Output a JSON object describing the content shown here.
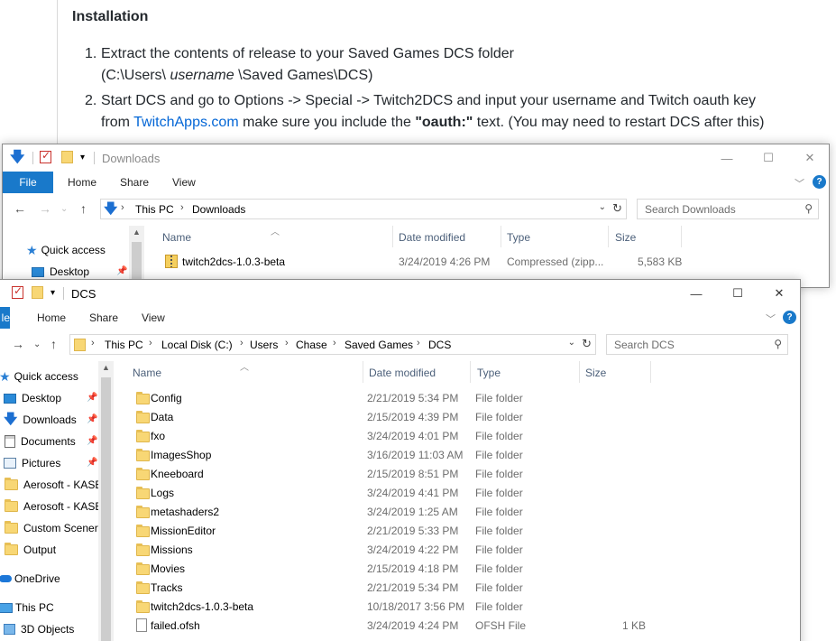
{
  "readme": {
    "heading": "Installation",
    "step1": {
      "num": "1.",
      "line1": "Extract the contents of release to your Saved Games DCS folder",
      "line2_pre": "(C:\\Users\\",
      "line2_em": "username",
      "line2_post": "\\Saved Games\\DCS)"
    },
    "step2": {
      "num": "2.",
      "line1": "Start DCS and go to Options -> Special -> Twitch2DCS and input your username and Twitch oauth key",
      "line2_pre": "from ",
      "line2_link": "TwitchApps.com",
      "line2_mid": " make sure you include the ",
      "line2_bold": "\"oauth:\"",
      "line2_post": " text. (You may need to restart DCS after this)"
    }
  },
  "downloads_window": {
    "title": "Downloads",
    "controls": {
      "minimize": "—",
      "maximize": "☐",
      "close": "✕"
    },
    "ribbon_tabs": [
      "File",
      "Home",
      "Share",
      "View"
    ],
    "address": {
      "crumbs": [
        "This PC",
        "Downloads"
      ]
    },
    "search_placeholder": "Search Downloads",
    "columns": [
      "Name",
      "Date modified",
      "Type",
      "Size"
    ],
    "nav": [
      {
        "label": "Quick access",
        "icon": "star-icon"
      },
      {
        "label": "Desktop",
        "icon": "desktop-icon"
      }
    ],
    "files": [
      {
        "name": "twitch2dcs-1.0.3-beta",
        "date": "3/24/2019 4:26 PM",
        "type": "Compressed (zipp...",
        "size": "5,583 KB",
        "icon": "zip-icon"
      }
    ]
  },
  "dcs_window": {
    "title": "DCS",
    "controls": {
      "minimize": "—",
      "maximize": "☐",
      "close": "✕"
    },
    "ribbon_tabs": [
      "le",
      "Home",
      "Share",
      "View"
    ],
    "address": {
      "crumbs": [
        "This PC",
        "Local Disk (C:)",
        "Users",
        "Chase",
        "Saved Games",
        "DCS"
      ]
    },
    "search_placeholder": "Search DCS",
    "columns": [
      "Name",
      "Date modified",
      "Type",
      "Size"
    ],
    "nav": [
      {
        "label": "Quick access",
        "icon": "star-icon",
        "pinned": false
      },
      {
        "label": "Desktop",
        "icon": "desktop-icon",
        "pinned": true
      },
      {
        "label": "Downloads",
        "icon": "download-icon",
        "pinned": true
      },
      {
        "label": "Documents",
        "icon": "documents-icon",
        "pinned": true
      },
      {
        "label": "Pictures",
        "icon": "pictures-icon",
        "pinned": true
      },
      {
        "label": "Aerosoft - KASE",
        "icon": "folder-icon",
        "pinned": false
      },
      {
        "label": "Aerosoft - KASE",
        "icon": "folder-icon",
        "pinned": false
      },
      {
        "label": "Custom Scenery",
        "icon": "folder-icon",
        "pinned": false
      },
      {
        "label": "Output",
        "icon": "folder-icon",
        "pinned": false
      },
      {
        "label": "OneDrive",
        "icon": "onedrive-icon",
        "pinned": false
      },
      {
        "label": "This PC",
        "icon": "computer-icon",
        "pinned": false
      },
      {
        "label": "3D Objects",
        "icon": "3d-objects-icon",
        "pinned": false
      }
    ],
    "files": [
      {
        "name": "Config",
        "date": "2/21/2019 5:34 PM",
        "type": "File folder",
        "size": "",
        "icon": "folder-icon"
      },
      {
        "name": "Data",
        "date": "2/15/2019 4:39 PM",
        "type": "File folder",
        "size": "",
        "icon": "folder-icon"
      },
      {
        "name": "fxo",
        "date": "3/24/2019 4:01 PM",
        "type": "File folder",
        "size": "",
        "icon": "folder-icon"
      },
      {
        "name": "ImagesShop",
        "date": "3/16/2019 11:03 AM",
        "type": "File folder",
        "size": "",
        "icon": "folder-icon"
      },
      {
        "name": "Kneeboard",
        "date": "2/15/2019 8:51 PM",
        "type": "File folder",
        "size": "",
        "icon": "folder-icon"
      },
      {
        "name": "Logs",
        "date": "3/24/2019 4:41 PM",
        "type": "File folder",
        "size": "",
        "icon": "folder-icon"
      },
      {
        "name": "metashaders2",
        "date": "3/24/2019 1:25 AM",
        "type": "File folder",
        "size": "",
        "icon": "folder-icon"
      },
      {
        "name": "MissionEditor",
        "date": "2/21/2019 5:33 PM",
        "type": "File folder",
        "size": "",
        "icon": "folder-icon"
      },
      {
        "name": "Missions",
        "date": "3/24/2019 4:22 PM",
        "type": "File folder",
        "size": "",
        "icon": "folder-icon"
      },
      {
        "name": "Movies",
        "date": "2/15/2019 4:18 PM",
        "type": "File folder",
        "size": "",
        "icon": "folder-icon"
      },
      {
        "name": "Tracks",
        "date": "2/21/2019 5:34 PM",
        "type": "File folder",
        "size": "",
        "icon": "folder-icon"
      },
      {
        "name": "twitch2dcs-1.0.3-beta",
        "date": "10/18/2017 3:56 PM",
        "type": "File folder",
        "size": "",
        "icon": "folder-icon"
      },
      {
        "name": "failed.ofsh",
        "date": "3/24/2019 4:24 PM",
        "type": "OFSH File",
        "size": "1 KB",
        "icon": "file-icon"
      }
    ]
  },
  "colors": {
    "accent": "#1979ca",
    "link": "#0366d6",
    "header_text": "#4c607a"
  }
}
